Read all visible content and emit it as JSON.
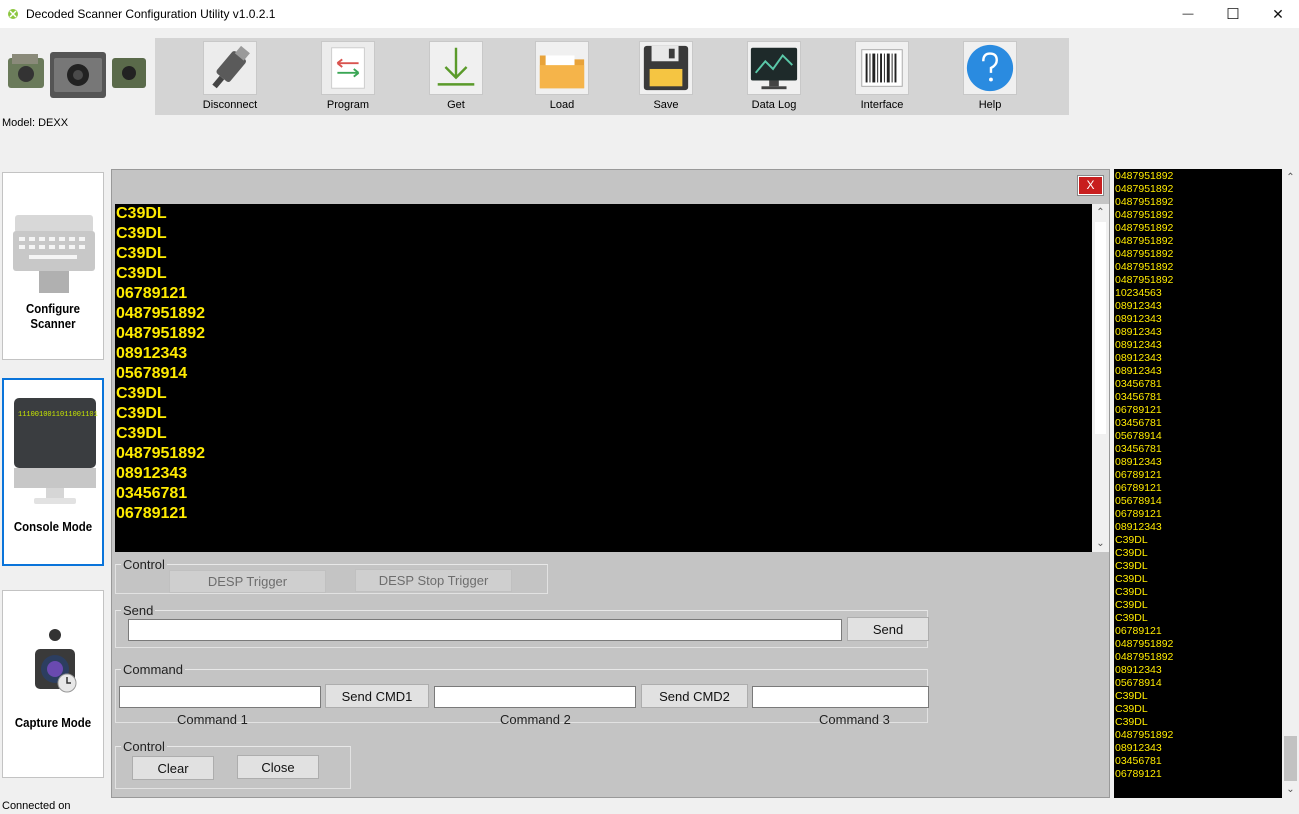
{
  "window": {
    "title": "Decoded Scanner Configuration Utility v1.0.2.1",
    "minimize": "—",
    "maximize": "☐",
    "close": "✕"
  },
  "model_label": "Model: DEXX",
  "status_text": "Connected on",
  "toolbar": {
    "buttons": [
      {
        "label": "Disconnect",
        "icon": "usb-plug-icon"
      },
      {
        "label": "Program",
        "icon": "program-arrows-icon"
      },
      {
        "label": "Get",
        "icon": "download-arrow-icon"
      },
      {
        "label": "Load",
        "icon": "folder-icon"
      },
      {
        "label": "Save",
        "icon": "floppy-disk-icon"
      },
      {
        "label": "Data Log",
        "icon": "monitor-chart-icon"
      },
      {
        "label": "Interface",
        "icon": "barcode-icon"
      },
      {
        "label": "Help",
        "icon": "question-icon"
      }
    ]
  },
  "sidebar": {
    "items": [
      {
        "label": "Configure Scanner",
        "icon": "keyboard-icon"
      },
      {
        "label": "Console Mode",
        "icon": "monitor-icon"
      },
      {
        "label": "Capture Mode",
        "icon": "camera-icon"
      }
    ]
  },
  "panel": {
    "close_label": "X",
    "console_lines": [
      "C39DL",
      "C39DL",
      "C39DL",
      "C39DL",
      "06789121",
      "0487951892",
      "0487951892",
      "08912343",
      "05678914",
      "C39DL",
      "C39DL",
      "C39DL",
      "0487951892",
      "08912343",
      "03456781",
      "06789121"
    ],
    "control_group": {
      "label": "Control",
      "trigger_label": "DESP Trigger",
      "stop_trigger_label": "DESP Stop Trigger"
    },
    "send_group": {
      "label": "Send",
      "input_value": "",
      "send_label": "Send"
    },
    "command_group": {
      "label": "Command",
      "cmd1_value": "",
      "cmd2_value": "",
      "cmd3_value": "",
      "send_cmd1_label": "Send CMD1",
      "send_cmd2_label": "Send CMD2",
      "command1_label": "Command 1",
      "command2_label": "Command 2",
      "command3_label": "Command 3"
    },
    "control2_group": {
      "label": "Control",
      "clear_label": "Clear",
      "close_label": "Close"
    }
  },
  "right_log": [
    "0487951892",
    "0487951892",
    "0487951892",
    "0487951892",
    "0487951892",
    "0487951892",
    "0487951892",
    "0487951892",
    "0487951892",
    "10234563",
    "08912343",
    "08912343",
    "08912343",
    "08912343",
    "08912343",
    "08912343",
    "03456781",
    "03456781",
    "06789121",
    "03456781",
    "05678914",
    "03456781",
    "08912343",
    "06789121",
    "06789121",
    "05678914",
    "06789121",
    "08912343",
    "C39DL",
    "C39DL",
    "C39DL",
    "C39DL",
    "C39DL",
    "C39DL",
    "C39DL",
    "06789121",
    "0487951892",
    "0487951892",
    "08912343",
    "05678914",
    "C39DL",
    "C39DL",
    "C39DL",
    "0487951892",
    "08912343",
    "03456781",
    "06789121"
  ],
  "colors": {
    "console_text": "#ffeb00",
    "console_bg": "#000000",
    "active_border": "#0a74da",
    "close_button": "#c81e1e"
  }
}
